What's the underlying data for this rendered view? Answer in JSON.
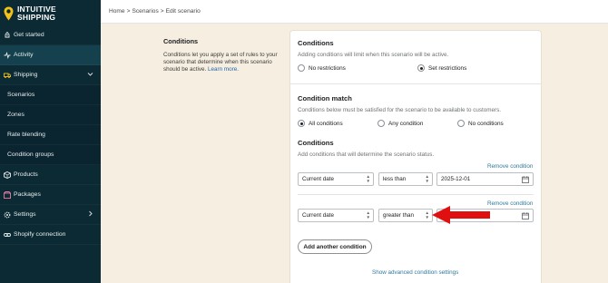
{
  "app": {
    "logo_line1": "INTUITIVE",
    "logo_line2": "SHIPPING"
  },
  "nav": {
    "items": [
      {
        "label": "Get started",
        "icon": "rocket-icon"
      },
      {
        "label": "Activity",
        "icon": "activity-icon"
      },
      {
        "label": "Shipping",
        "icon": "truck-icon"
      },
      {
        "label": "Scenarios"
      },
      {
        "label": "Zones"
      },
      {
        "label": "Rate blending"
      },
      {
        "label": "Condition groups"
      },
      {
        "label": "Products",
        "icon": "box-icon"
      },
      {
        "label": "Packages",
        "icon": "package-icon"
      },
      {
        "label": "Settings",
        "icon": "gear-icon"
      },
      {
        "label": "Shopify connection",
        "icon": "link-icon"
      }
    ]
  },
  "breadcrumb": {
    "home": "Home",
    "scenarios": "Scenarios",
    "current": "Edit scenario",
    "separator": ">"
  },
  "description": {
    "title": "Conditions",
    "text": "Conditions let you apply a set of rules to your scenario that determine when this scenario should be active.",
    "link": "Learn more."
  },
  "conditions_section": {
    "title": "Conditions",
    "subtitle": "Adding conditions will limit when this scenario will be active.",
    "option_none": "No restrictions",
    "option_set": "Set restrictions"
  },
  "match_section": {
    "title": "Condition match",
    "subtitle": "Conditions below must be satisfied for the scenario to be available to customers.",
    "option_all": "All conditions",
    "option_any": "Any condition",
    "option_none": "No conditions"
  },
  "rules_section": {
    "title": "Conditions",
    "subtitle": "Add conditions that will determine the scenario status.",
    "remove_label": "Remove condition",
    "rows": [
      {
        "field": "Current date",
        "operator": "less than",
        "value": "2025-12-01"
      },
      {
        "field": "Current date",
        "operator": "greater than",
        "value": ""
      }
    ],
    "add_button": "Add another condition",
    "advanced_link": "Show advanced condition settings"
  },
  "colors": {
    "sidebar_bg": "#0c2a33",
    "logo_yellow": "#f2c21b",
    "arrow_red": "#e01010",
    "link": "#2f7a9a"
  }
}
